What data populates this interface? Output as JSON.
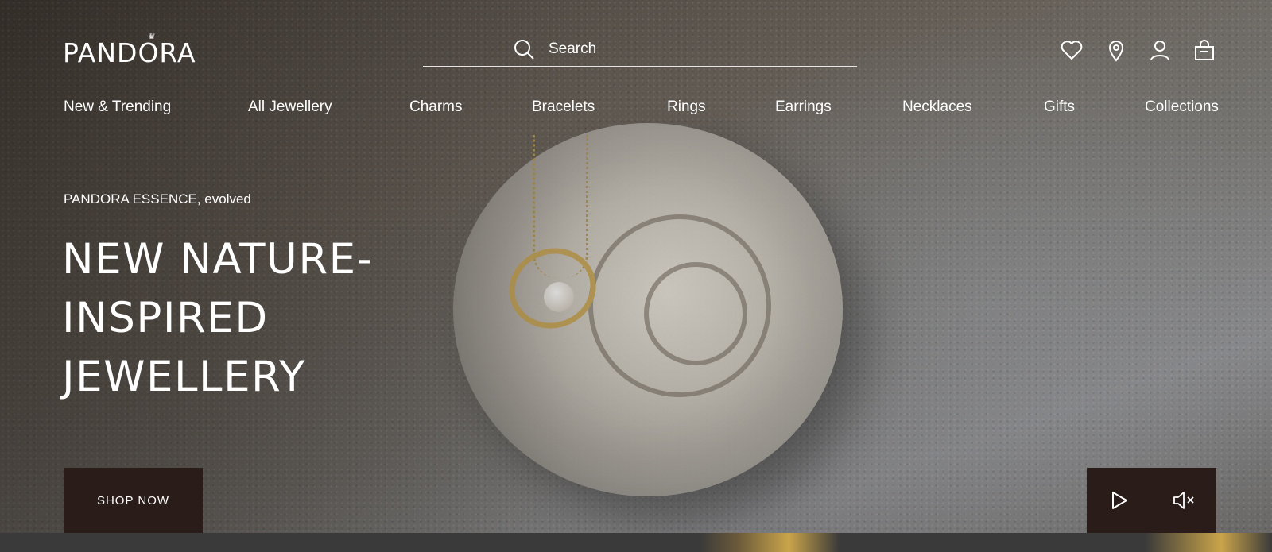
{
  "brand": {
    "logo": "PANDORA",
    "crown": "♛"
  },
  "search": {
    "placeholder": "Search"
  },
  "utility_icons": [
    "heart-icon",
    "location-pin-icon",
    "user-icon",
    "shopping-bag-icon"
  ],
  "nav": {
    "items": [
      "New & Trending",
      "All Jewellery",
      "Charms",
      "Bracelets",
      "Rings",
      "Earrings",
      "Necklaces",
      "Gifts",
      "Collections"
    ]
  },
  "hero": {
    "eyebrow": "PANDORA ESSENCE, evolved",
    "headline_line1": "NEW NATURE-",
    "headline_line2": "INSPIRED",
    "headline_line3": "JEWELLERY",
    "cta": "SHOP NOW"
  },
  "media_controls": {
    "play_icon": "play-icon",
    "mute_icon": "mute-icon"
  },
  "colors": {
    "cta_background": "#2a1c18",
    "text": "#ffffff"
  }
}
